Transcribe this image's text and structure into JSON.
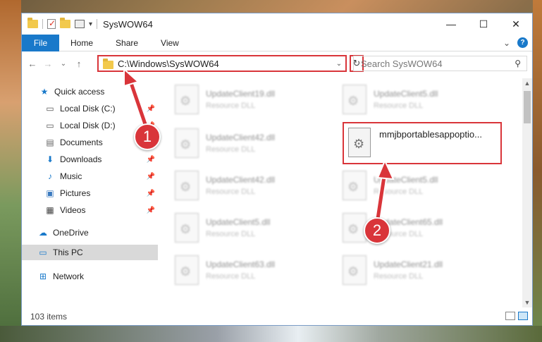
{
  "window": {
    "title": "SysWOW64",
    "controls": {
      "minimize": "—",
      "maximize": "☐",
      "close": "✕"
    }
  },
  "ribbon": {
    "file_tab": "File",
    "tabs": [
      "Home",
      "Share",
      "View"
    ],
    "help": "?",
    "expand": "⌄"
  },
  "address": {
    "path": "C:\\Windows\\SysWOW64",
    "search_placeholder": "Search SysWOW64"
  },
  "nav": {
    "back": "←",
    "forward": "→",
    "recent": "⌄",
    "up": "↑",
    "refresh": "↻",
    "dropdown": "⌄",
    "search_icon": "⚲"
  },
  "sidebar": {
    "items": [
      {
        "label": "Quick access",
        "icon": "star-icon"
      },
      {
        "label": "Local Disk (C:)",
        "icon": "drive-icon"
      },
      {
        "label": "Local Disk (D:)",
        "icon": "drive-icon"
      },
      {
        "label": "Documents",
        "icon": "documents-icon"
      },
      {
        "label": "Downloads",
        "icon": "download-icon"
      },
      {
        "label": "Music",
        "icon": "music-icon"
      },
      {
        "label": "Pictures",
        "icon": "pictures-icon"
      },
      {
        "label": "Videos",
        "icon": "videos-icon"
      },
      {
        "label": "OneDrive",
        "icon": "cloud-icon"
      },
      {
        "label": "This PC",
        "icon": "computer-icon"
      },
      {
        "label": "Network",
        "icon": "network-icon"
      }
    ]
  },
  "files": [
    {
      "name": "UpdateClient19.dll",
      "type": "Resource DLL"
    },
    {
      "name": "UpdateClient5.dll",
      "type": "Resource DLL"
    },
    {
      "name": "UpdateClient42.dll",
      "type": "Resource DLL"
    },
    {
      "name": "UpdateClient42.dll",
      "type": "Resource DLL"
    },
    {
      "name": "UpdateClient5.dll",
      "type": "Resource DLL"
    },
    {
      "name": "UpdateClient5.dll",
      "type": "Resource DLL"
    },
    {
      "name": "UpdateClient65.dll",
      "type": "Resource DLL"
    },
    {
      "name": "UpdateClient63.dll",
      "type": "Resource DLL"
    },
    {
      "name": "UpdateClient21.dll",
      "type": "Resource DLL"
    }
  ],
  "highlighted_file": {
    "name": "mmjbportablesappoptio..."
  },
  "status": {
    "item_count": "103 items"
  },
  "annotations": {
    "step1": "1",
    "step2": "2"
  },
  "colors": {
    "accent": "#1979ca",
    "highlight": "#d9353a"
  }
}
